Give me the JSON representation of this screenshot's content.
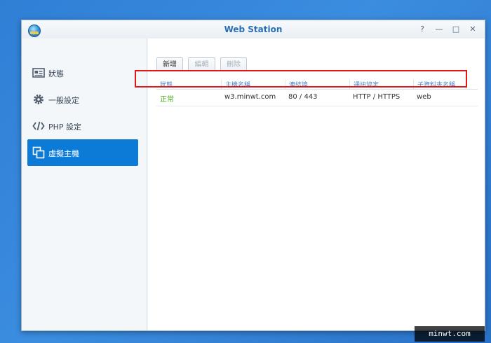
{
  "window": {
    "title": "Web Station",
    "controls": {
      "help": "?",
      "minimize": "—",
      "maximize": "□",
      "close": "✕"
    }
  },
  "sidebar": {
    "items": [
      {
        "label": "狀態",
        "icon": "status-card-icon",
        "active": false
      },
      {
        "label": "一般設定",
        "icon": "gear-icon",
        "active": false
      },
      {
        "label": "PHP 設定",
        "icon": "code-icon",
        "active": false
      },
      {
        "label": "虛擬主機",
        "icon": "virtual-host-icon",
        "active": true
      }
    ]
  },
  "toolbar": {
    "add_label": "新增",
    "edit_label": "編輯",
    "delete_label": "刪除"
  },
  "table": {
    "columns": [
      "狀態",
      "主機名稱",
      "連結埠",
      "通訊協定",
      "子資料夾名稱"
    ],
    "rows": [
      {
        "status": "正常",
        "hostname": "w3.minwt.com",
        "port": "80 / 443",
        "protocol": "HTTP / HTTPS",
        "folder": "web"
      }
    ]
  },
  "watermark": {
    "text": "minwt.com"
  },
  "colors": {
    "accent": "#0b7bd7",
    "status_ok": "#46a817",
    "highlight": "#e01818"
  }
}
